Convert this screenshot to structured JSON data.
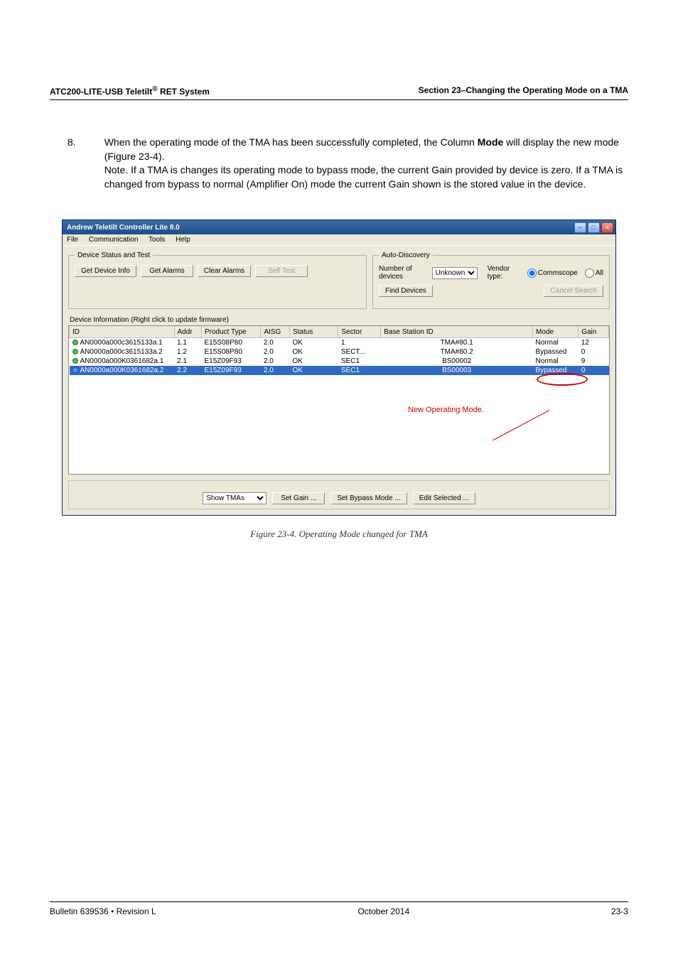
{
  "header": {
    "left_prefix": "ATC200-LITE-USB Teletilt",
    "left_suffix": " RET System",
    "right": "Section 23–Changing the Operating Mode on a TMA"
  },
  "step": {
    "num": "8.",
    "line1_a": "When the operating mode of the TMA has been successfully completed, the Column ",
    "line1_bold": "Mode",
    "line1_b": " will display the new mode (Figure 23-4).",
    "line2": "Note.  If a TMA is changes its operating mode to bypass mode, the current Gain provided by device is zero.  If a TMA is changed from bypass to normal (Amplifier On) mode the current Gain shown is the stored value in the device."
  },
  "window": {
    "title": "Andrew Teletilt Controller Lite 8.0",
    "menu": [
      "File",
      "Communication",
      "Tools",
      "Help"
    ],
    "groups": {
      "device_status_legend": "Device Status and Test",
      "auto_legend": "Auto-Discovery",
      "buttons": {
        "get_info": "Get Device Info",
        "get_alarms": "Get Alarms",
        "clear_alarms": "Clear Alarms",
        "self_test": "Self Test",
        "find_devices": "Find Devices",
        "cancel_search": "Cancel Search"
      },
      "num_devices_label": "Number of devices",
      "num_devices_value": "Unknown",
      "vendor_label": "Vendor type:",
      "vendor_commscope": "Commscope",
      "vendor_all": "All"
    },
    "subheader": "Device Information (Right click to update firmware)",
    "columns": [
      "ID",
      "Addr",
      "Product Type",
      "AISG",
      "Status",
      "Sector",
      "Base Station ID",
      "Mode",
      "Gain"
    ],
    "rows": [
      {
        "led": "green",
        "id": "AN0000a000c3615133a.1",
        "addr": "1.1",
        "ptype": "E15S08P80",
        "aisg": "2.0",
        "status": "OK",
        "sector": "1",
        "bsid": "TMA#80.1",
        "mode": "Normal",
        "gain": "12",
        "sel": false
      },
      {
        "led": "green",
        "id": "AN0000a000c3615133a.2",
        "addr": "1.2",
        "ptype": "E15S08P80",
        "aisg": "2.0",
        "status": "OK",
        "sector": "SECT...",
        "bsid": "TMA#80.2",
        "mode": "Bypassed",
        "gain": "0",
        "sel": false
      },
      {
        "led": "green",
        "id": "AN0000a000K0361682a.1",
        "addr": "2.1",
        "ptype": "E15Z09F93",
        "aisg": "2.0",
        "status": "OK",
        "sector": "SEC1",
        "bsid": "BS00002",
        "mode": "Normal",
        "gain": "9",
        "sel": false
      },
      {
        "led": "blue",
        "id": "AN0000a000K0361682a.2",
        "addr": "2.2",
        "ptype": "E15Z09F93",
        "aisg": "2.0",
        "status": "OK",
        "sector": "SEC1",
        "bsid": "BS00003",
        "mode": "Bypassed",
        "gain": "0",
        "sel": true
      }
    ],
    "annotation": "New Operating Mode.",
    "bottom": {
      "show_select": "Show TMAs",
      "set_gain": "Set Gain ...",
      "set_bypass": "Set Bypass Mode ...",
      "edit_selected": "Edit Selected ..."
    }
  },
  "figure_caption": "Figure 23-4. Operating Mode changed for TMA",
  "footer": {
    "left": "Bulletin 639536  •  Revision L",
    "center": "October 2014",
    "right": "23-3"
  }
}
